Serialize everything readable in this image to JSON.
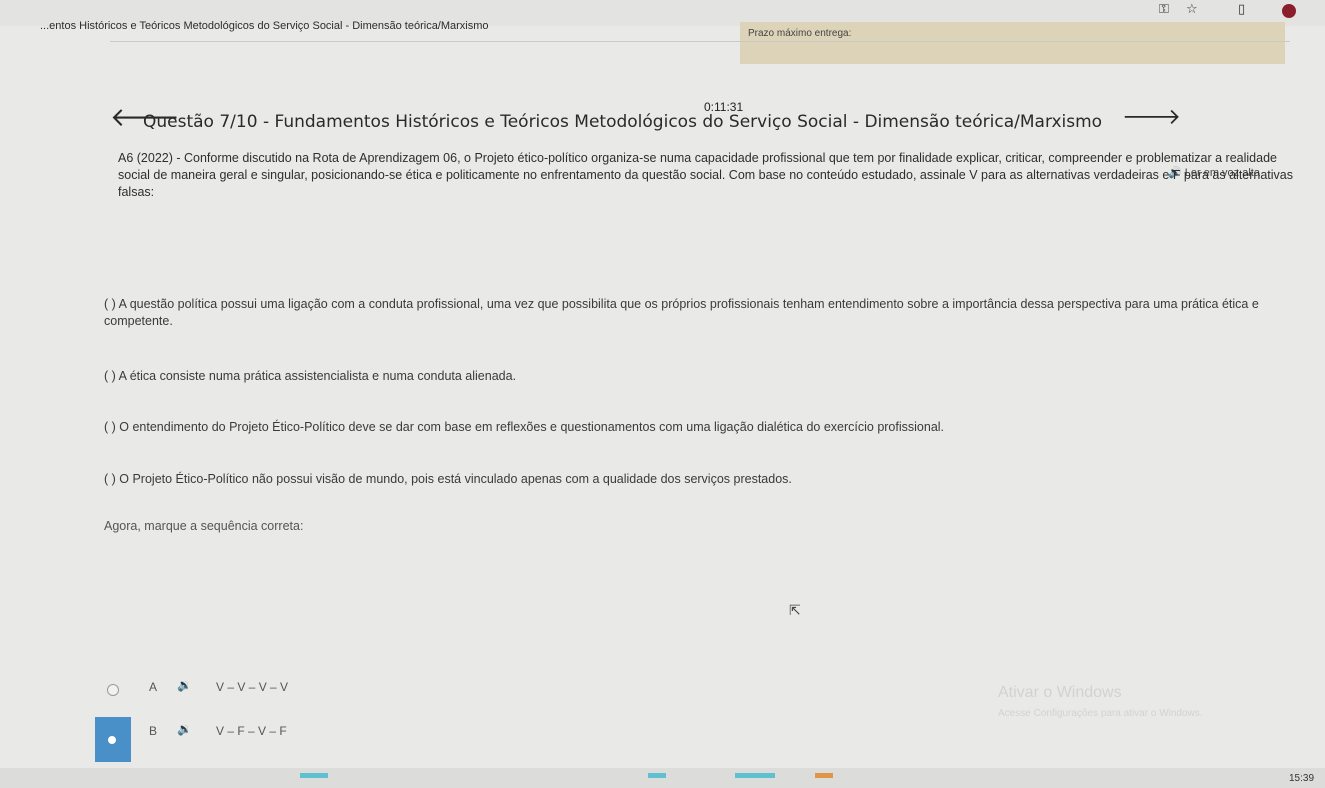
{
  "browser": {
    "key_icon": "key-icon",
    "star_icon": "star-icon",
    "extensions_icon": "extensions-icon",
    "profile_color": "#8a1f2b"
  },
  "header": {
    "course_title": "...entos Históricos e Teóricos Metodológicos do Serviço Social - Dimensão teórica/Marxismo",
    "deadline_label": "Prazo máximo entrega:"
  },
  "timer": "0:11:31",
  "question": {
    "title": "Questão 7/10 - Fundamentos Históricos e Teóricos Metodológicos do Serviço Social - Dimensão teórica/Marxismo",
    "read_aloud": "Ler em voz alta",
    "stem": "A6 (2022) - Conforme discutido na Rota de Aprendizagem 06, o Projeto ético-político organiza-se numa capacidade profissional que tem por finalidade explicar, criticar, compreender e problematizar a realidade social de maneira geral e singular, posicionando-se ética e politicamente no enfrentamento da questão social. Com base no conteúdo estudado, assinale V para as alternativas verdadeiras e F para as alternativas falsas:",
    "items": [
      "( ) A questão política possui uma ligação com a conduta profissional, uma vez que possibilita que os próprios profissionais tenham entendimento sobre a importância dessa perspectiva para uma prática ética e competente.",
      "( ) A ética consiste numa prática assistencialista e numa conduta alienada.",
      "( ) O entendimento do Projeto Ético-Político deve se dar com base em reflexões e questionamentos com uma ligação dialética do exercício profissional.",
      "( ) O Projeto Ético-Político não possui visão de mundo, pois está vinculado apenas com a qualidade dos serviços prestados."
    ],
    "prompt": "Agora, marque a sequência correta:"
  },
  "options": [
    {
      "letter": "A",
      "text": "V – V – V – V",
      "selected": false
    },
    {
      "letter": "B",
      "text": "V – F – V – F",
      "selected": true
    }
  ],
  "watermark": {
    "line1": "Ativar o Windows",
    "line2": "Acesse Configurações para ativar o Windows."
  },
  "taskbar": {
    "clock": "15:39"
  },
  "colors": {
    "selected_option": "#4a90c8",
    "deadline_bg": "#ddd3b9"
  }
}
